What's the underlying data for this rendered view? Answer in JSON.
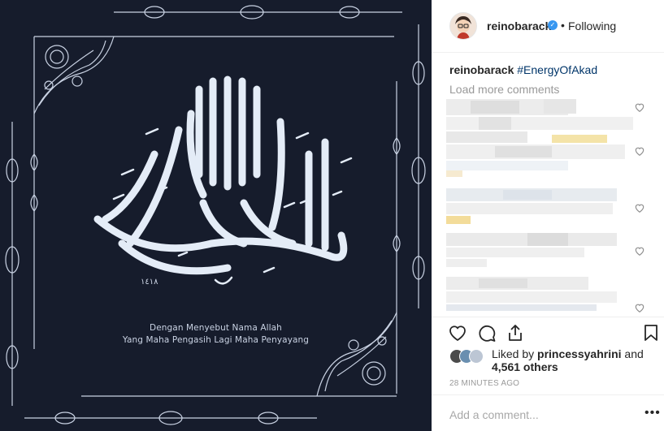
{
  "post": {
    "image_caption_line1": "Dengan Menyebut Nama Allah",
    "image_caption_line2": "Yang Maha Pengasih Lagi Maha Penyayang",
    "image_year": "١٤١٨",
    "image_bg": "#161c2c",
    "ornament_color": "#c9d2e3"
  },
  "header": {
    "username": "reinobarack",
    "verified_icon": "verified-badge-icon",
    "separator": "•",
    "follow_label": "Following"
  },
  "caption": {
    "username": "reinobarack",
    "hashtag": "#EnergyOfAkad"
  },
  "comments": {
    "load_more_label": "Load more comments",
    "items_blurred": 5
  },
  "actions": {
    "like_icon": "heart-icon",
    "comment_icon": "comment-icon",
    "share_icon": "share-icon",
    "save_icon": "bookmark-icon"
  },
  "likes": {
    "prefix": "Liked by ",
    "liker": "princessyahrini",
    "suffix_and": " and",
    "others": "4,561 others"
  },
  "timestamp": "28 MINUTES AGO",
  "comment_box": {
    "placeholder": "Add a comment...",
    "more_label": "•••"
  },
  "colors": {
    "link": "#003569",
    "verified": "#3897f0",
    "muted": "#999999",
    "text": "#262626"
  }
}
